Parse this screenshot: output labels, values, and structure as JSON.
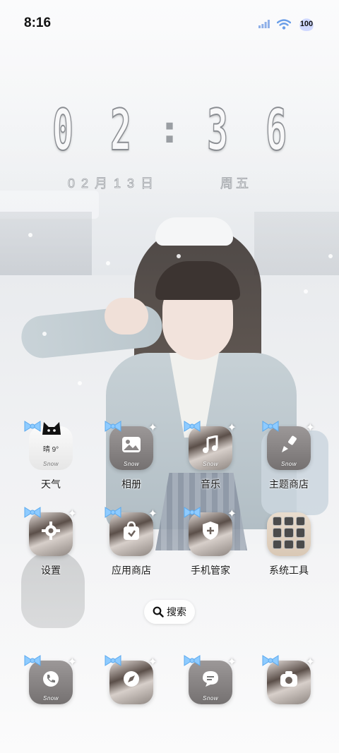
{
  "status_bar": {
    "time": "8:16",
    "battery": "100",
    "icons": [
      "signal-icon",
      "wifi-icon",
      "battery-icon"
    ]
  },
  "clock_widget": {
    "hour_tens": "0",
    "hour_ones": "2",
    "colon": ":",
    "minute_tens": "3",
    "minute_ones": "6",
    "date": "02月13日",
    "weekday": "周五"
  },
  "apps": [
    {
      "label": "天气",
      "icon": "weather-icon",
      "weather_text": "晴 9°",
      "snow": "Snow"
    },
    {
      "label": "相册",
      "icon": "gallery-icon",
      "snow": "Snow"
    },
    {
      "label": "音乐",
      "icon": "music-icon",
      "snow": "Snow"
    },
    {
      "label": "主题商店",
      "icon": "theme-brush-icon",
      "snow": "Snow"
    },
    {
      "label": "设置",
      "icon": "settings-gear-icon"
    },
    {
      "label": "应用商店",
      "icon": "app-store-bag-icon"
    },
    {
      "label": "手机管家",
      "icon": "phone-manager-shield-icon"
    },
    {
      "label": "系统工具",
      "icon": "system-tools-folder-icon"
    }
  ],
  "search": {
    "label": "搜索",
    "icon": "search-icon"
  },
  "dock": [
    {
      "icon": "phone-icon",
      "snow": "Snow"
    },
    {
      "icon": "browser-icon"
    },
    {
      "icon": "messages-icon",
      "snow": "Snow"
    },
    {
      "icon": "camera-icon"
    }
  ],
  "colors": {
    "bow": "#8ecbff",
    "label_text": "#1a1a1a",
    "clock_stroke": "#8a8d92"
  }
}
